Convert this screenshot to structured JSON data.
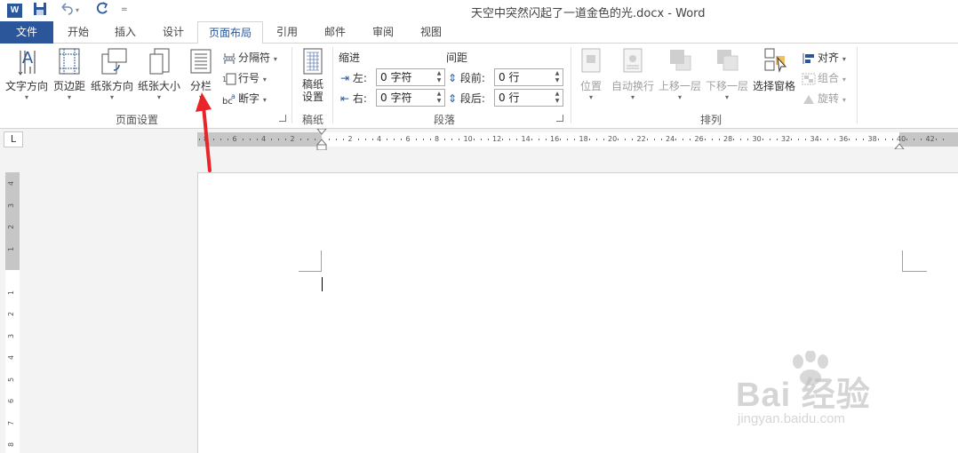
{
  "window": {
    "title": "天空中突然闪起了一道金色的光.docx - Word",
    "app_icon_letter": "W"
  },
  "quick_access": {
    "save_icon": "save-icon",
    "undo_icon": "undo-icon",
    "redo_icon": "redo-icon",
    "customize_icon": "customize-icon"
  },
  "tabs": [
    {
      "label": "文件"
    },
    {
      "label": "开始"
    },
    {
      "label": "插入"
    },
    {
      "label": "设计"
    },
    {
      "label": "页面布局"
    },
    {
      "label": "引用"
    },
    {
      "label": "邮件"
    },
    {
      "label": "审阅"
    },
    {
      "label": "视图"
    }
  ],
  "ribbon": {
    "page_setup": {
      "label": "页面设置",
      "text_direction": "文字方向",
      "margins": "页边距",
      "orientation": "纸张方向",
      "size": "纸张大小",
      "columns": "分栏",
      "breaks": "分隔符",
      "line_numbers": "行号",
      "hyphenation": "断字"
    },
    "manuscript": {
      "label": "稿纸",
      "button_line1": "稿纸",
      "button_line2": "设置"
    },
    "paragraph": {
      "label": "段落",
      "indent_title": "缩进",
      "spacing_title": "间距",
      "left_label": "左:",
      "right_label": "右:",
      "left_value": "0 字符",
      "right_value": "0 字符",
      "before_label": "段前:",
      "after_label": "段后:",
      "before_value": "0 行",
      "after_value": "0 行"
    },
    "arrange": {
      "label": "排列",
      "position": "位置",
      "wrap_text": "自动换行",
      "bring_forward": "上移一层",
      "send_backward": "下移一层",
      "selection_pane": "选择窗格",
      "align": "对齐",
      "group": "组合",
      "rotate": "旋转"
    }
  },
  "ruler": {
    "tab_selector": "L",
    "h_labels": [
      "8",
      "6",
      "4",
      "2",
      "2",
      "4",
      "6",
      "8",
      "10",
      "12",
      "14",
      "16",
      "18",
      "20",
      "22",
      "24",
      "26",
      "28",
      "30",
      "32",
      "34",
      "36",
      "38",
      "40",
      "42"
    ],
    "v_labels": [
      "4",
      "3",
      "2",
      "1",
      "1",
      "2",
      "3",
      "4",
      "5",
      "6",
      "7",
      "8"
    ]
  },
  "watermark": {
    "brand": "Bai 经验",
    "url": "jingyan.baidu.com"
  },
  "colors": {
    "word_blue": "#2b579a",
    "annotation_red": "#e8262a"
  }
}
